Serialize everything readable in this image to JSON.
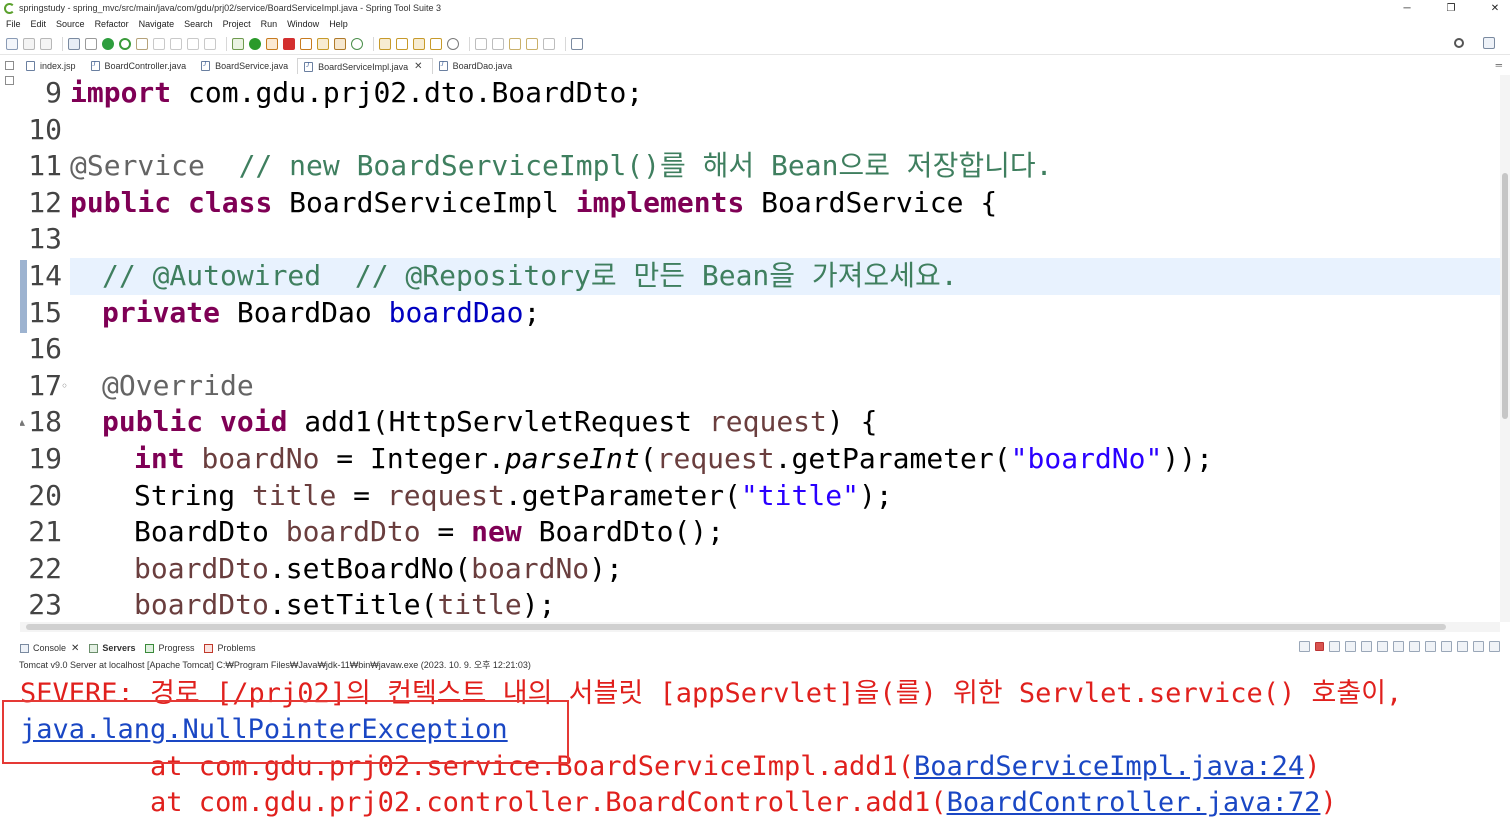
{
  "window": {
    "title": "springstudy - spring_mvc/src/main/java/com/gdu/prj02/service/BoardServiceImpl.java - Spring Tool Suite 3",
    "minimize": "─",
    "restore": "❐",
    "close": "✕"
  },
  "menu": [
    "File",
    "Edit",
    "Source",
    "Refactor",
    "Navigate",
    "Search",
    "Project",
    "Run",
    "Window",
    "Help"
  ],
  "editor_tabs": [
    {
      "label": "index.jsp",
      "icon": "jsp-file-icon",
      "active": false
    },
    {
      "label": "BoardController.java",
      "icon": "java-file-icon",
      "active": false
    },
    {
      "label": "BoardService.java",
      "icon": "java-file-icon",
      "active": false
    },
    {
      "label": "BoardServiceImpl.java",
      "icon": "java-file-icon",
      "active": true,
      "close": "✕"
    },
    {
      "label": "BoardDao.java",
      "icon": "java-file-icon",
      "active": false
    }
  ],
  "code": {
    "line_numbers": [
      "9",
      "10",
      "11",
      "12",
      "13",
      "14",
      "15",
      "16",
      "17",
      "18",
      "19",
      "20",
      "21",
      "22",
      "23"
    ],
    "l9": {
      "kw": "import",
      "rest": " com.gdu.prj02.dto.BoardDto;"
    },
    "l11": {
      "ann": "@Service",
      "cm": "  // new BoardServiceImpl()를 해서 Bean으로 저장합니다."
    },
    "l12": {
      "kw1": "public",
      "kw2": "class",
      "name": " BoardServiceImpl ",
      "kw3": "implements",
      "rest": " BoardService {"
    },
    "l14": {
      "cm": "// @Autowired  // @Repository로 만든 Bean을 가져오세요."
    },
    "l15": {
      "kw": "private",
      "type": " BoardDao ",
      "field": "boardDao",
      "rest": ";"
    },
    "l17": {
      "ann": "@Override"
    },
    "l18": {
      "kw1": "public",
      "kw2": "void",
      "name": " add1(HttpServletRequest ",
      "param": "request",
      "rest": ") {"
    },
    "l19": {
      "kw": "int",
      "var": "boardNo",
      "eq": " = Integer.",
      "method": "parseInt",
      "open": "(",
      "param": "request",
      "call": ".getParameter(",
      "str": "\"boardNo\"",
      "rest": "));"
    },
    "l20": {
      "type": "String ",
      "var": "title",
      "eq": " = ",
      "param": "request",
      "call": ".getParameter(",
      "str": "\"title\"",
      "rest": ");"
    },
    "l21": {
      "type": "BoardDto ",
      "var": "boardDto",
      "eq": " = ",
      "kw": "new",
      "rest": " BoardDto();"
    },
    "l22": {
      "var": "boardDto",
      "call": ".setBoardNo(",
      "arg": "boardNo",
      "rest": ");"
    },
    "l23": {
      "var": "boardDto",
      "call": ".setTitle(",
      "arg": "title",
      "rest": ");"
    }
  },
  "panel": {
    "tabs": [
      {
        "label": "Console",
        "close": "✕",
        "bold": false
      },
      {
        "label": "Servers",
        "bold": true
      },
      {
        "label": "Progress",
        "bold": false
      },
      {
        "label": "Problems",
        "bold": false
      }
    ],
    "server_description": "Tomcat v9.0 Server at localhost [Apache Tomcat] C:₩Program Files₩Java₩jdk-11₩bin₩javaw.exe  (2023. 10. 9. 오후 12:21:03)"
  },
  "console": {
    "line1": "SEVERE: 경로 [/prj02]의 컨텍스트 내의 서블릿 [appServlet]을(를) 위한 Servlet.service() 호출이,",
    "exception": "java.lang.NullPointerException",
    "at1_prefix": "        at com.gdu.prj02.service.BoardServiceImpl.add1(",
    "at1_link": "BoardServiceImpl.java:24",
    "at2_prefix": "        at com.gdu.prj02.controller.BoardController.add1(",
    "at2_link": "BoardController.java:72",
    "close_paren": ")"
  }
}
